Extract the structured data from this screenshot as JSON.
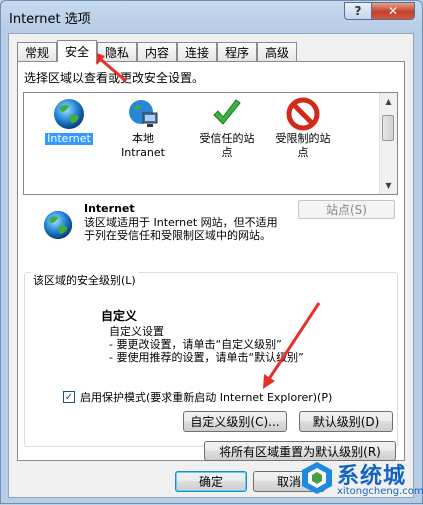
{
  "window": {
    "title": "Internet 选项"
  },
  "titlebar": {
    "help_glyph": "?",
    "close_glyph": "✕"
  },
  "tabs": [
    {
      "label": "常规"
    },
    {
      "label": "安全"
    },
    {
      "label": "隐私"
    },
    {
      "label": "内容"
    },
    {
      "label": "连接"
    },
    {
      "label": "程序"
    },
    {
      "label": "高级"
    }
  ],
  "active_tab": "安全",
  "panel": {
    "heading": "选择区域以查看或更改安全设置。"
  },
  "zones": [
    {
      "line1": "Internet",
      "line2": "",
      "icon": "globe-icon",
      "selected": true
    },
    {
      "line1": "本地",
      "line2": "Intranet",
      "icon": "intranet-icon",
      "selected": false
    },
    {
      "line1": "受信任的站",
      "line2": "点",
      "icon": "check-icon",
      "selected": false
    },
    {
      "line1": "受限制的站",
      "line2": "点",
      "icon": "restricted-icon",
      "selected": false
    }
  ],
  "scrollbar": {
    "up": "▲",
    "down": "▼"
  },
  "zone_detail": {
    "title": "Internet",
    "description": "该区域适用于 Internet 网站，但不适用于列在受信任和受限制区域中的网站。",
    "sites_button": "站点(S)"
  },
  "security_level": {
    "group_label": "该区域的安全级别(L)",
    "level_name": "自定义",
    "line1": "自定义设置",
    "line2": "- 要更改设置，请单击“自定义级别”",
    "line3": "- 要使用推荐的设置，请单击“默认级别”"
  },
  "protected_mode": {
    "checked": true,
    "check_glyph": "✓",
    "label": "启用保护模式(要求重新启动 Internet Explorer)(P)"
  },
  "buttons": {
    "custom_level": "自定义级别(C)...",
    "default_level": "默认级别(D)",
    "reset_all": "将所有区域重置为默认级别(R)",
    "ok": "确定",
    "cancel": "取消"
  },
  "watermark": {
    "text": "系统城",
    "url": "xitongcheng.com"
  },
  "colors": {
    "annotation_arrow": "#e8302a",
    "selection": "#3399ff",
    "watermark": "#1565c0"
  }
}
